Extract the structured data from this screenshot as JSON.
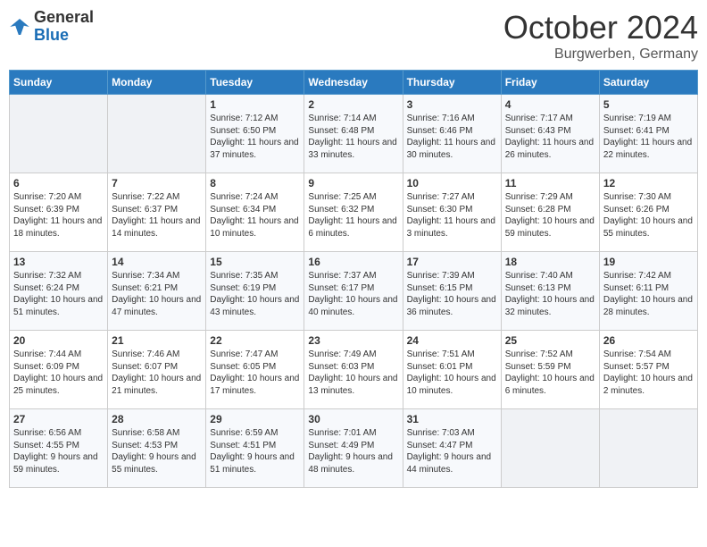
{
  "logo": {
    "general": "General",
    "blue": "Blue"
  },
  "title": "October 2024",
  "location": "Burgwerben, Germany",
  "days_of_week": [
    "Sunday",
    "Monday",
    "Tuesday",
    "Wednesday",
    "Thursday",
    "Friday",
    "Saturday"
  ],
  "weeks": [
    [
      {
        "day": "",
        "content": ""
      },
      {
        "day": "",
        "content": ""
      },
      {
        "day": "1",
        "content": "Sunrise: 7:12 AM\nSunset: 6:50 PM\nDaylight: 11 hours and 37 minutes."
      },
      {
        "day": "2",
        "content": "Sunrise: 7:14 AM\nSunset: 6:48 PM\nDaylight: 11 hours and 33 minutes."
      },
      {
        "day": "3",
        "content": "Sunrise: 7:16 AM\nSunset: 6:46 PM\nDaylight: 11 hours and 30 minutes."
      },
      {
        "day": "4",
        "content": "Sunrise: 7:17 AM\nSunset: 6:43 PM\nDaylight: 11 hours and 26 minutes."
      },
      {
        "day": "5",
        "content": "Sunrise: 7:19 AM\nSunset: 6:41 PM\nDaylight: 11 hours and 22 minutes."
      }
    ],
    [
      {
        "day": "6",
        "content": "Sunrise: 7:20 AM\nSunset: 6:39 PM\nDaylight: 11 hours and 18 minutes."
      },
      {
        "day": "7",
        "content": "Sunrise: 7:22 AM\nSunset: 6:37 PM\nDaylight: 11 hours and 14 minutes."
      },
      {
        "day": "8",
        "content": "Sunrise: 7:24 AM\nSunset: 6:34 PM\nDaylight: 11 hours and 10 minutes."
      },
      {
        "day": "9",
        "content": "Sunrise: 7:25 AM\nSunset: 6:32 PM\nDaylight: 11 hours and 6 minutes."
      },
      {
        "day": "10",
        "content": "Sunrise: 7:27 AM\nSunset: 6:30 PM\nDaylight: 11 hours and 3 minutes."
      },
      {
        "day": "11",
        "content": "Sunrise: 7:29 AM\nSunset: 6:28 PM\nDaylight: 10 hours and 59 minutes."
      },
      {
        "day": "12",
        "content": "Sunrise: 7:30 AM\nSunset: 6:26 PM\nDaylight: 10 hours and 55 minutes."
      }
    ],
    [
      {
        "day": "13",
        "content": "Sunrise: 7:32 AM\nSunset: 6:24 PM\nDaylight: 10 hours and 51 minutes."
      },
      {
        "day": "14",
        "content": "Sunrise: 7:34 AM\nSunset: 6:21 PM\nDaylight: 10 hours and 47 minutes."
      },
      {
        "day": "15",
        "content": "Sunrise: 7:35 AM\nSunset: 6:19 PM\nDaylight: 10 hours and 43 minutes."
      },
      {
        "day": "16",
        "content": "Sunrise: 7:37 AM\nSunset: 6:17 PM\nDaylight: 10 hours and 40 minutes."
      },
      {
        "day": "17",
        "content": "Sunrise: 7:39 AM\nSunset: 6:15 PM\nDaylight: 10 hours and 36 minutes."
      },
      {
        "day": "18",
        "content": "Sunrise: 7:40 AM\nSunset: 6:13 PM\nDaylight: 10 hours and 32 minutes."
      },
      {
        "day": "19",
        "content": "Sunrise: 7:42 AM\nSunset: 6:11 PM\nDaylight: 10 hours and 28 minutes."
      }
    ],
    [
      {
        "day": "20",
        "content": "Sunrise: 7:44 AM\nSunset: 6:09 PM\nDaylight: 10 hours and 25 minutes."
      },
      {
        "day": "21",
        "content": "Sunrise: 7:46 AM\nSunset: 6:07 PM\nDaylight: 10 hours and 21 minutes."
      },
      {
        "day": "22",
        "content": "Sunrise: 7:47 AM\nSunset: 6:05 PM\nDaylight: 10 hours and 17 minutes."
      },
      {
        "day": "23",
        "content": "Sunrise: 7:49 AM\nSunset: 6:03 PM\nDaylight: 10 hours and 13 minutes."
      },
      {
        "day": "24",
        "content": "Sunrise: 7:51 AM\nSunset: 6:01 PM\nDaylight: 10 hours and 10 minutes."
      },
      {
        "day": "25",
        "content": "Sunrise: 7:52 AM\nSunset: 5:59 PM\nDaylight: 10 hours and 6 minutes."
      },
      {
        "day": "26",
        "content": "Sunrise: 7:54 AM\nSunset: 5:57 PM\nDaylight: 10 hours and 2 minutes."
      }
    ],
    [
      {
        "day": "27",
        "content": "Sunrise: 6:56 AM\nSunset: 4:55 PM\nDaylight: 9 hours and 59 minutes."
      },
      {
        "day": "28",
        "content": "Sunrise: 6:58 AM\nSunset: 4:53 PM\nDaylight: 9 hours and 55 minutes."
      },
      {
        "day": "29",
        "content": "Sunrise: 6:59 AM\nSunset: 4:51 PM\nDaylight: 9 hours and 51 minutes."
      },
      {
        "day": "30",
        "content": "Sunrise: 7:01 AM\nSunset: 4:49 PM\nDaylight: 9 hours and 48 minutes."
      },
      {
        "day": "31",
        "content": "Sunrise: 7:03 AM\nSunset: 4:47 PM\nDaylight: 9 hours and 44 minutes."
      },
      {
        "day": "",
        "content": ""
      },
      {
        "day": "",
        "content": ""
      }
    ]
  ]
}
